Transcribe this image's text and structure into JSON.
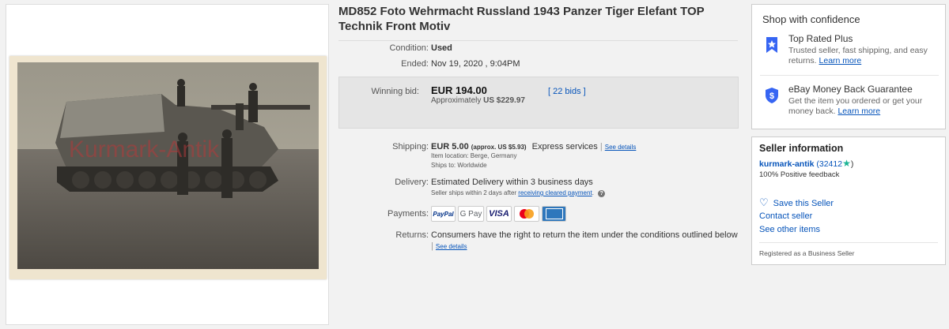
{
  "photo": {
    "watermark": "Kurmark-Antik"
  },
  "item": {
    "title": "MD852 Foto Wehrmacht Russland 1943 Panzer Tiger Elefant TOP Technik Front Motiv",
    "condition_label": "Condition:",
    "condition_value": "Used",
    "ended_label": "Ended:",
    "ended_value": "Nov 19, 2020 , 9:04PM",
    "bid_label": "Winning bid:",
    "bid_amount": "EUR 194.00",
    "bid_approx_prefix": "Approximately",
    "bid_approx_value": "US $229.97",
    "bids_link": "22 bids",
    "shipping_label": "Shipping:",
    "shipping_cost": "EUR 5.00",
    "shipping_approx": "(approx. US $5.93)",
    "shipping_service": "Express services",
    "shipping_details": "See details",
    "item_location": "Item location:  Berge, Germany",
    "ships_to": "Ships to:  Worldwide",
    "delivery_label": "Delivery:",
    "delivery_value": "Estimated Delivery within 3 business days",
    "delivery_note": "Seller ships within 2 days after",
    "delivery_link": "receiving cleared payment",
    "payments_label": "Payments:",
    "payment_methods": [
      "PayPal",
      "G Pay",
      "VISA",
      "mastercard",
      "AMERICAN EXPRESS"
    ],
    "returns_label": "Returns:",
    "returns_value": "Consumers have the right to return the item under the conditions outlined below",
    "returns_details": "See details"
  },
  "confidence": {
    "title": "Shop with confidence",
    "items": [
      {
        "icon": "top-rated-badge-icon",
        "head": "Top Rated Plus",
        "desc": "Trusted seller, fast shipping, and easy returns.",
        "link": "Learn more"
      },
      {
        "icon": "money-back-shield-icon",
        "head": "eBay Money Back Guarantee",
        "desc": "Get the item you ordered or get your money back.",
        "link": "Learn more"
      }
    ]
  },
  "seller": {
    "title": "Seller information",
    "name": "kurmark-antik",
    "feedback_count_open": "(32412",
    "feedback_count_close": ")",
    "positive": "100% Positive feedback",
    "save": "Save this Seller",
    "contact": "Contact seller",
    "other_items": "See other items",
    "business": "Registered as a Business Seller"
  },
  "colors": {
    "link": "#0654ba",
    "bid_box": "#e5e5e5",
    "star": "#1ab394",
    "badge": "#3665f3"
  }
}
